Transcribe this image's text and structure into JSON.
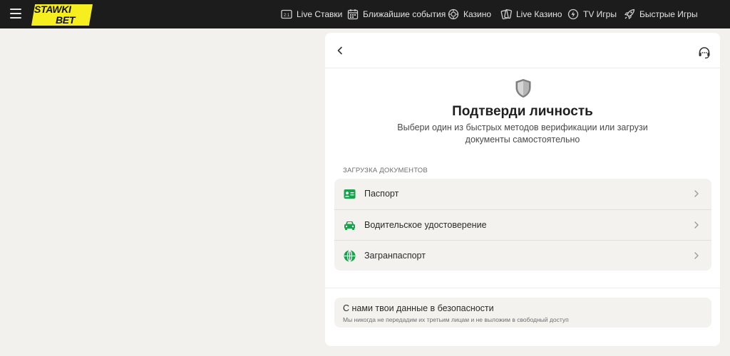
{
  "header": {
    "logo_top": "STAWKI",
    "logo_bottom": "BET",
    "nav": [
      {
        "label": "Live Ставки",
        "icon": "live-score-icon"
      },
      {
        "label": "Ближайшие события",
        "icon": "calendar-icon"
      },
      {
        "label": "Казино",
        "icon": "casino-chip-icon"
      },
      {
        "label": "Live Казино",
        "icon": "playing-cards-icon"
      },
      {
        "label": "TV Игры",
        "icon": "tv-games-icon"
      },
      {
        "label": "Быстрые Игры",
        "icon": "rocket-icon"
      }
    ]
  },
  "verification": {
    "title": "Подтверди личность",
    "subtitle": "Выбери один из быстрых методов верификации или загрузи документы самостоятельно",
    "section_label": "ЗАГРУЗКА ДОКУМЕНТОВ",
    "documents": [
      {
        "label": "Паспорт",
        "icon": "id-card-icon"
      },
      {
        "label": "Водительское удостоверение",
        "icon": "car-icon"
      },
      {
        "label": "Загранпаспорт",
        "icon": "globe-icon"
      }
    ],
    "security_title": "С нами твои данные в безопасности",
    "security_text": "Мы никогда не передадим их третьим лицам и не выложим в свободный доступ"
  },
  "colors": {
    "topbar": "#1c1c1c",
    "logo_yellow": "#f6ee1f",
    "accent_green": "#16a34a",
    "page_bg": "#f3f1ed"
  }
}
